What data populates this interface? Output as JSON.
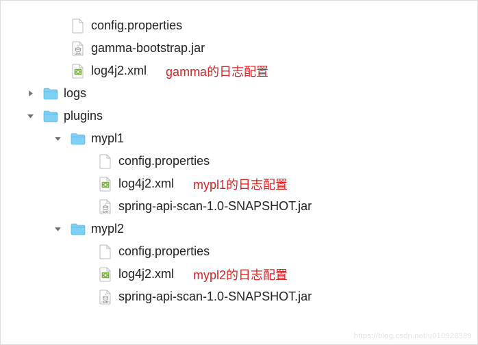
{
  "tree": {
    "items": [
      {
        "depth": 1,
        "disclosure": "none",
        "iconType": "file-blank",
        "label": "config.properties",
        "annotation": ""
      },
      {
        "depth": 1,
        "disclosure": "none",
        "iconType": "file-jar",
        "label": "gamma-bootstrap.jar",
        "annotation": ""
      },
      {
        "depth": 1,
        "disclosure": "none",
        "iconType": "file-xml",
        "label": "log4j2.xml",
        "annotation": "gamma的日志配置"
      },
      {
        "depth": 0,
        "disclosure": "closed",
        "iconType": "folder",
        "label": "logs",
        "annotation": ""
      },
      {
        "depth": 0,
        "disclosure": "open",
        "iconType": "folder",
        "label": "plugins",
        "annotation": ""
      },
      {
        "depth": 1,
        "disclosure": "open",
        "iconType": "folder",
        "label": "mypl1",
        "annotation": ""
      },
      {
        "depth": 2,
        "disclosure": "none",
        "iconType": "file-blank",
        "label": "config.properties",
        "annotation": ""
      },
      {
        "depth": 2,
        "disclosure": "none",
        "iconType": "file-xml",
        "label": "log4j2.xml",
        "annotation": "mypl1的日志配置"
      },
      {
        "depth": 2,
        "disclosure": "none",
        "iconType": "file-jar",
        "label": "spring-api-scan-1.0-SNAPSHOT.jar",
        "annotation": ""
      },
      {
        "depth": 1,
        "disclosure": "open",
        "iconType": "folder",
        "label": "mypl2",
        "annotation": ""
      },
      {
        "depth": 2,
        "disclosure": "none",
        "iconType": "file-blank",
        "label": "config.properties",
        "annotation": ""
      },
      {
        "depth": 2,
        "disclosure": "none",
        "iconType": "file-xml",
        "label": "log4j2.xml",
        "annotation": "mypl2的日志配置"
      },
      {
        "depth": 2,
        "disclosure": "none",
        "iconType": "file-jar",
        "label": "spring-api-scan-1.0-SNAPSHOT.jar",
        "annotation": ""
      }
    ]
  },
  "layout": {
    "baseIndentPx": 32,
    "depthIndentPx": 40,
    "disclosureSlotPx": 22
  },
  "colors": {
    "annotation": "#d22",
    "folder": "#6ec7f0",
    "text": "#222"
  },
  "watermark": "https://blog.csdn.net/u010928589"
}
